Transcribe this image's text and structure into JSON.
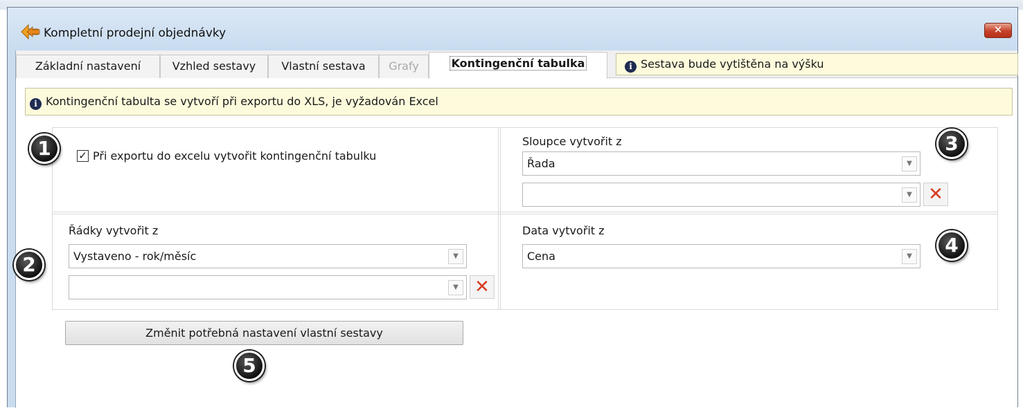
{
  "window": {
    "title": "Kompletní prodejní objednávky",
    "close_label": "✕"
  },
  "tabs": [
    {
      "label": "Základní nastavení",
      "state": "normal"
    },
    {
      "label": "Vzhled sestavy",
      "state": "normal"
    },
    {
      "label": "Vlastní sestava",
      "state": "normal"
    },
    {
      "label": "Grafy",
      "state": "disabled"
    },
    {
      "label": "Kontingenční tabulka",
      "state": "active"
    }
  ],
  "tab_info": "Sestava bude vytištěna na výšku",
  "notice": "Kontingenční tabulta se vytvoří při exportu do XLS, je vyžadován Excel",
  "pivot": {
    "create_checkbox": {
      "label": "Při exportu do excelu vytvořit kontingenční tabulku",
      "checked": true
    },
    "columns": {
      "label": "Sloupce vytvořit z",
      "value_1": "Řada",
      "value_2": ""
    },
    "rows": {
      "label": "Řádky vytvořit z",
      "value_1": "Vystaveno - rok/měsíc",
      "value_2": ""
    },
    "data": {
      "label": "Data vytvořit z",
      "value": "Cena"
    }
  },
  "action_button": "Změnit potřebná nastavení vlastní sestavy",
  "markers": [
    "1",
    "2",
    "3",
    "4",
    "5"
  ],
  "icons": {
    "app": "report-arrows-icon",
    "info": "info-icon",
    "dropdown": "chevron-down-icon",
    "remove": "red-x-icon"
  },
  "colors": {
    "info_background": "#fefbdc",
    "remove_icon": "#d63b1d",
    "close_button": "#c6402a"
  }
}
